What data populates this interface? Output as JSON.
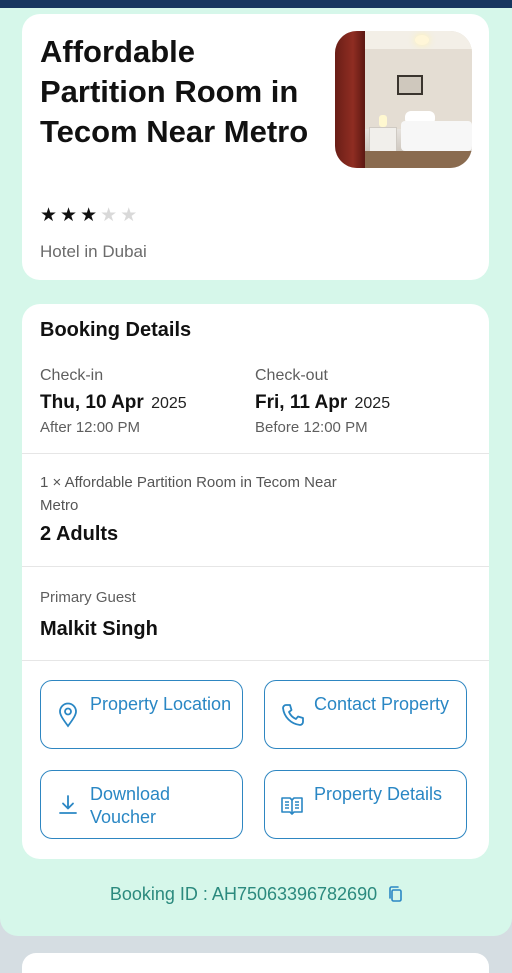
{
  "hotel": {
    "title": "Affordable Partition Room in Tecom Near Metro",
    "rating": 3,
    "rating_max": 5,
    "type": "Hotel in Dubai",
    "photo_icon": "hotel-room-photo"
  },
  "booking": {
    "section_title": "Booking Details",
    "checkin": {
      "label": "Check-in",
      "date": "Thu, 10 Apr",
      "year": "2025",
      "time": "After  12:00 PM"
    },
    "checkout": {
      "label": "Check-out",
      "date": "Fri, 11 Apr",
      "year": "2025",
      "time": "Before  12:00 PM"
    },
    "room_line": "1 × Affordable Partition Room in Tecom Near Metro",
    "guests": "2 Adults",
    "primary_guest_label": "Primary Guest",
    "primary_guest_name": "Malkit  Singh"
  },
  "actions": [
    {
      "label": "Property Location",
      "icon": "location-pin-icon"
    },
    {
      "label": "Contact Property",
      "icon": "phone-icon"
    },
    {
      "label": "Download Voucher",
      "icon": "download-icon"
    },
    {
      "label": "Property Details",
      "icon": "book-icon"
    }
  ],
  "footer": {
    "booking_id": "Booking ID : AH75063396782690",
    "copy_icon": "copy-icon"
  },
  "colors": {
    "header_bar": "#17365f",
    "mint_background": "#d6f7ea",
    "accent_blue": "#2a87c4",
    "booking_id_teal": "#2b8a7e"
  }
}
